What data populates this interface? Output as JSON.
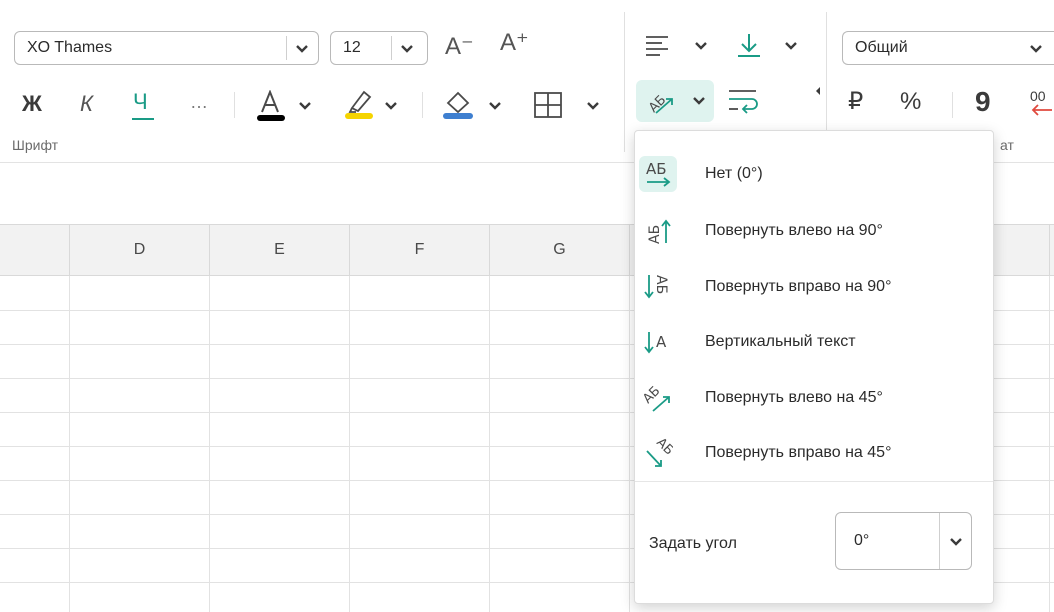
{
  "colors": {
    "accent": "#1a9b86",
    "font_underline": "#000000",
    "highlight_underline": "#f5d400",
    "fill_underline": "#3e7fd0",
    "selected_bg": "#dff3ef",
    "red_arrow": "#e04a3f"
  },
  "ribbon": {
    "font_name": "XO Thames",
    "font_size": "12",
    "decrease_font_glyph": "A⁻",
    "increase_font_glyph": "A⁺",
    "bold_glyph": "Ж",
    "italic_glyph": "К",
    "underline_glyph": "Ч",
    "more_glyph": "…",
    "font_group_label": "Шрифт",
    "format_group_label_fragment": "ат",
    "number_format": "Общий",
    "currency_glyph": "₽",
    "percent_glyph": "%",
    "comma_glyph": "9",
    "decimals_glyph": "00"
  },
  "sheet": {
    "columns": [
      "D",
      "E",
      "F",
      "G"
    ]
  },
  "rotation_menu": {
    "items": [
      {
        "label": "Нет (0°)",
        "icon": "text-no-rotation-icon",
        "selected": true
      },
      {
        "label": "Повернуть влево на 90°",
        "icon": "rotate-left-90-icon",
        "selected": false
      },
      {
        "label": "Повернуть вправо на 90°",
        "icon": "rotate-right-90-icon",
        "selected": false
      },
      {
        "label": "Вертикальный текст",
        "icon": "vertical-text-icon",
        "selected": false
      },
      {
        "label": "Повернуть влево на 45°",
        "icon": "rotate-left-45-icon",
        "selected": false
      },
      {
        "label": "Повернуть вправо на 45°",
        "icon": "rotate-right-45-icon",
        "selected": false
      }
    ],
    "angle_label": "Задать угол",
    "angle_value": "0°"
  }
}
